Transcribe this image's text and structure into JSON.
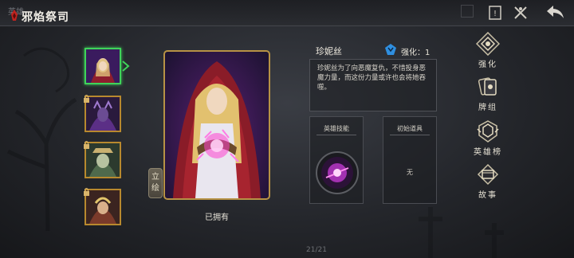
{
  "header": {
    "title": "邪焰祭司",
    "ghost_tab": "英雄"
  },
  "hero_list": [
    {
      "id": "hero-1",
      "selected": true,
      "locked": false
    },
    {
      "id": "hero-2",
      "selected": false,
      "locked": true
    },
    {
      "id": "hero-3",
      "selected": false,
      "locked": true
    },
    {
      "id": "hero-4",
      "selected": false,
      "locked": true
    }
  ],
  "portrait_toggle_label": "立绘",
  "hero": {
    "name": "珍妮丝",
    "upgrade_label": "强化：1",
    "description": "珍妮丝为了向恶魔复仇，不惜投身恶魔力量，而这份力量或许也会将她吞噬。",
    "owned_status": "已拥有",
    "skill_panel_title": "英雄技能",
    "item_panel_title": "初始道具",
    "item_none": "无"
  },
  "menu": [
    {
      "label": "强化",
      "icon": "upgrade-icon"
    },
    {
      "label": "牌组",
      "icon": "deck-icon"
    },
    {
      "label": "英雄榜",
      "icon": "leaderboard-icon"
    },
    {
      "label": "故事",
      "icon": "story-icon"
    }
  ],
  "pager": "21/21",
  "colors": {
    "accent_gold": "#b8892e",
    "selected_green": "#3fd35a",
    "rune_blue": "#2f8fe0"
  }
}
